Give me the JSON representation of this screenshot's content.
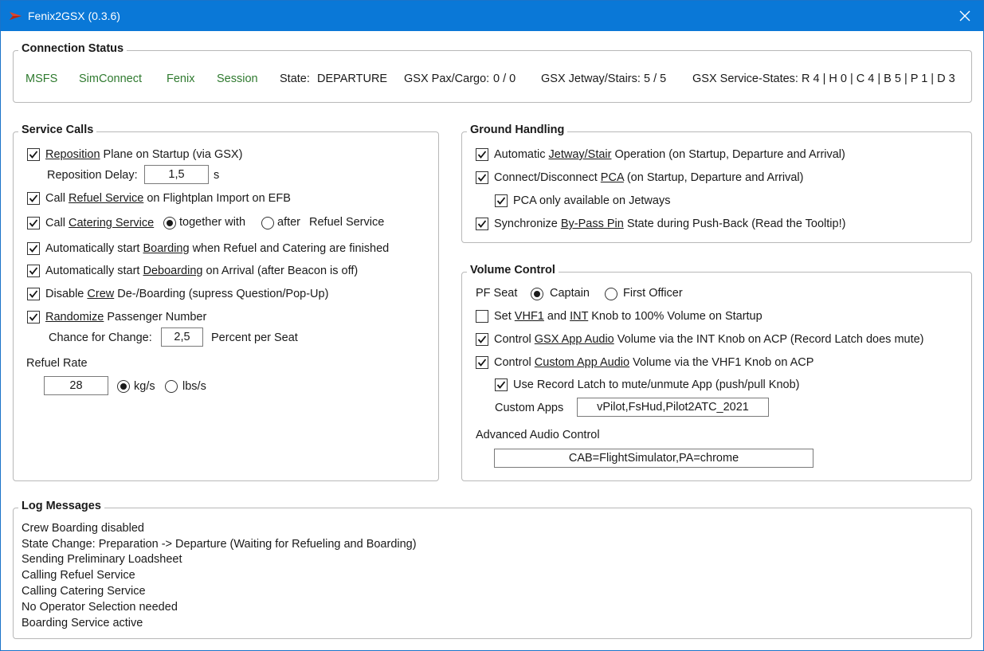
{
  "window": {
    "title": "Fenix2GSX  (0.3.6)"
  },
  "connection": {
    "legend": "Connection Status",
    "msfs": "MSFS",
    "simconnect": "SimConnect",
    "fenix": "Fenix",
    "session": "Session",
    "state_label": "State:",
    "state_value": "DEPARTURE",
    "pax_label": "GSX Pax/Cargo:",
    "pax_value": "0 / 0",
    "jetway_label": "GSX Jetway/Stairs:",
    "jetway_value": "5 / 5",
    "service_label": "GSX Service-States:",
    "service_value": "R 4 | H 0 | C 4 | B 5 | P 1 | D 3",
    "status_color": "#2f7a2f"
  },
  "service_calls": {
    "legend": "Service Calls",
    "reposition": {
      "u": "Reposition",
      "rest": " Plane on Startup (via GSX)",
      "checked": true
    },
    "reposition_delay_label": "Reposition Delay:",
    "reposition_delay_value": "1,5",
    "reposition_delay_unit": "s",
    "refuel": {
      "pre": "Call ",
      "u": "Refuel Service",
      "rest": " on Flightplan Import on EFB",
      "checked": true
    },
    "catering": {
      "pre": "Call ",
      "u": "Catering Service",
      "checked": true
    },
    "catering_together": "together with",
    "catering_after": "after",
    "catering_refuel": "Refuel Service",
    "boarding": {
      "pre": "Automatically start ",
      "u": "Boarding",
      "rest": " when Refuel and Catering are finished",
      "checked": true
    },
    "deboarding": {
      "pre": "Automatically start ",
      "u": "Deboarding",
      "rest": " on Arrival (after Beacon is off)",
      "checked": true
    },
    "crew": {
      "pre": "Disable ",
      "u": "Crew",
      "rest": " De-/Boarding (supress Question/Pop-Up)",
      "checked": true
    },
    "randomize": {
      "u": "Randomize",
      "rest": " Passenger Number",
      "checked": true
    },
    "chance_label": "Chance for Change:",
    "chance_value": "2,5",
    "chance_unit": "Percent per Seat",
    "refuel_rate_label": "Refuel Rate",
    "refuel_rate_value": "28",
    "unit_kgs": "kg/s",
    "unit_lbs": "lbs/s"
  },
  "ground_handling": {
    "legend": "Ground Handling",
    "jetway": {
      "pre": "Automatic ",
      "u": "Jetway/Stair",
      "rest": " Operation (on Startup, Departure and Arrival)",
      "checked": true
    },
    "pca": {
      "pre": "Connect/Disconnect ",
      "u": "PCA",
      "rest": " (on Startup, Departure and Arrival)",
      "checked": true
    },
    "pca_jetways": {
      "label": "PCA only available on Jetways",
      "checked": true
    },
    "bypass": {
      "pre": "Synchronize ",
      "u": "By-Pass Pin",
      "rest": " State during Push-Back (Read the Tooltip!)",
      "checked": true
    }
  },
  "volume_control": {
    "legend": "Volume Control",
    "pf_seat_label": "PF Seat",
    "captain": "Captain",
    "first_officer": "First Officer",
    "vhf1_startup": {
      "pre": "Set ",
      "u1": "VHF1",
      "mid": " and ",
      "u2": "INT",
      "rest": " Knob to 100% Volume on Startup",
      "checked": false
    },
    "gsx_audio": {
      "pre": "Control ",
      "u": "GSX App Audio",
      "rest": " Volume via the INT Knob on ACP (Record Latch does mute)",
      "checked": true
    },
    "custom_audio": {
      "pre": "Control ",
      "u": "Custom App Audio",
      "rest": " Volume via the VHF1 Knob on ACP",
      "checked": true
    },
    "record_latch": {
      "label": "Use Record Latch to mute/unmute App (push/pull Knob)",
      "checked": true
    },
    "custom_apps_label": "Custom Apps",
    "custom_apps_value": "vPilot,FsHud,Pilot2ATC_2021",
    "advanced_label": "Advanced Audio Control",
    "advanced_value": "CAB=FlightSimulator,PA=chrome"
  },
  "log": {
    "legend": "Log Messages",
    "lines": [
      "Crew Boarding disabled",
      "State Change: Preparation -> Departure (Waiting for Refueling and Boarding)",
      "Sending Preliminary Loadsheet",
      "Calling Refuel Service",
      "Calling Catering Service",
      "No Operator Selection needed",
      "Boarding Service active"
    ]
  }
}
